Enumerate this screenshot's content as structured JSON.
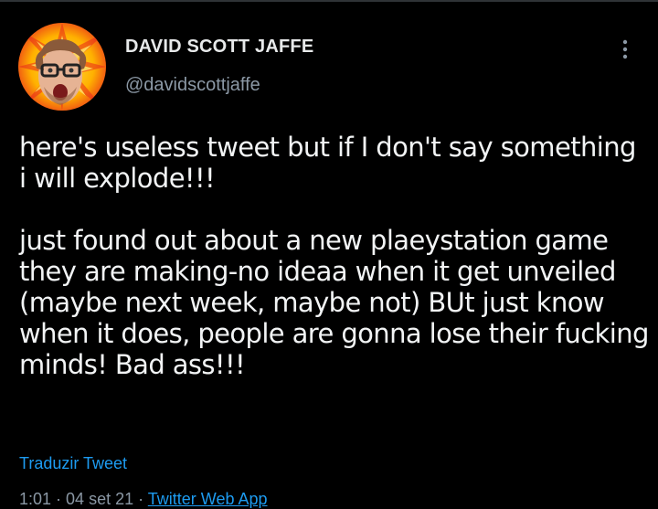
{
  "tweet": {
    "author": {
      "display_name": "DAVID SCOTT JAFFE",
      "handle": "@davidscottjaffe",
      "avatar_icon": "profile-photo"
    },
    "more_icon": "more-options-icon",
    "text": "here's useless tweet but if I don't say something i will explode!!!\n\njust found out about a new plaeystation game they are making-no ideaa when it get unveiled (maybe next week, maybe not) BUt just know when it does, people are gonna lose their fucking minds! Bad ass!!!",
    "translate_label": "Traduzir Tweet",
    "time": "1:01",
    "separator": " · ",
    "date": "04 set 21",
    "source": "Twitter Web App"
  },
  "colors": {
    "background": "#000000",
    "text": "#e7e9ea",
    "secondary": "#8b98a5",
    "link": "#1d9bf0"
  }
}
